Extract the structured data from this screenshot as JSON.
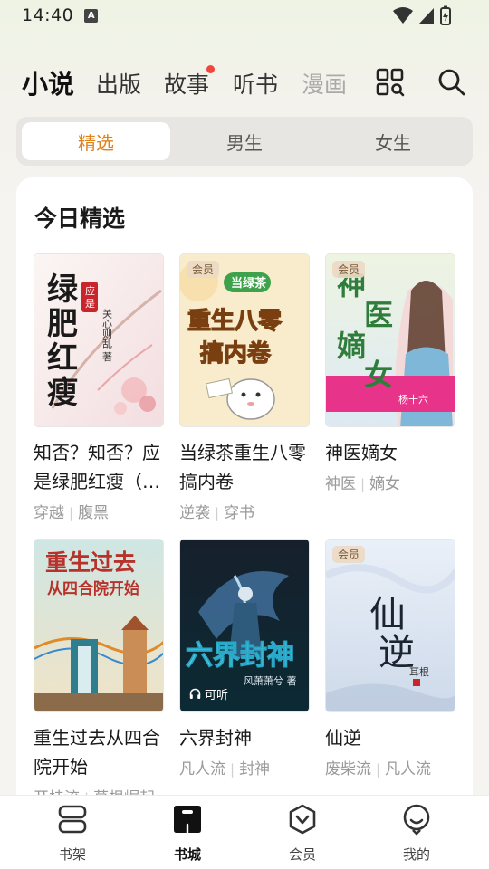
{
  "status_bar": {
    "time": "14:40",
    "notif_letter": "A"
  },
  "top_nav": {
    "tabs": [
      {
        "label": "小说"
      },
      {
        "label": "出版"
      },
      {
        "label": "故事"
      },
      {
        "label": "听书"
      },
      {
        "label": "漫画"
      }
    ]
  },
  "segments": [
    {
      "label": "精选"
    },
    {
      "label": "男生"
    },
    {
      "label": "女生"
    }
  ],
  "section": {
    "title": "今日精选",
    "books": [
      {
        "title": "知否？知否？应是绿肥红瘦（赵丽颖、冯绍峰主演原著）",
        "tags": [
          "穿越",
          "腹黑"
        ],
        "cover_text": "绿肥红瘦",
        "cover_sub": "应是",
        "cover_author": "关心则乱 著"
      },
      {
        "title": "当绿茶重生八零搞内卷",
        "tags": [
          "逆袭",
          "穿书"
        ],
        "badge": "会员",
        "cover_text": "重生八零",
        "cover_sub": "搞内卷",
        "cover_tag": "当绿茶"
      },
      {
        "title": "神医嫡女",
        "tags": [
          "神医",
          "嫡女"
        ],
        "badge": "会员",
        "cover_text": "神医嫡女",
        "cover_author": "杨十六"
      },
      {
        "title": "重生过去从四合院开始",
        "tags": [
          "开挂流",
          "草根崛起"
        ],
        "cover_text": "重生过去",
        "cover_sub": "从四合院开始"
      },
      {
        "title": "六界封神",
        "tags": [
          "凡人流",
          "封神"
        ],
        "listen_badge": "可听",
        "cover_text": "六界封神",
        "cover_author": "风萧萧兮 著"
      },
      {
        "title": "仙逆",
        "tags": [
          "废柴流",
          "凡人流"
        ],
        "badge": "会员",
        "cover_text": "仙逆",
        "cover_author": "耳根"
      }
    ]
  },
  "bottom_nav": [
    {
      "label": "书架"
    },
    {
      "label": "书城"
    },
    {
      "label": "会员"
    },
    {
      "label": "我的"
    }
  ],
  "colors": {
    "accent": "#e0821a",
    "dot": "#f0463c"
  }
}
